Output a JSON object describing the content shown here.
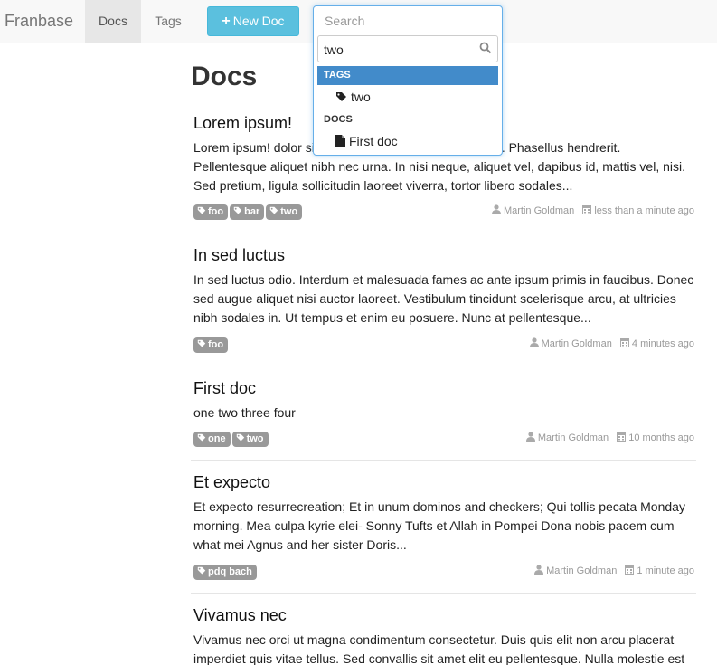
{
  "navbar": {
    "brand": "Franbase",
    "docs_label": "Docs",
    "tags_label": "Tags",
    "new_doc_label": "New Doc"
  },
  "search": {
    "placeholder": "Search",
    "value": "two",
    "tags_header": "TAGS",
    "tag_results": [
      "two"
    ],
    "docs_header": "DOCS",
    "doc_results": [
      "First doc"
    ]
  },
  "main": {
    "title": "Docs",
    "docs": [
      {
        "title": "Lorem ipsum!",
        "body": "Lorem ipsum! dolor sit amet, consectetur adipiscing elit. Phasellus hendrerit. Pellentesque aliquet nibh nec urna. In nisi neque, aliquet vel, dapibus id, mattis vel, nisi. Sed pretium, ligula sollicitudin laoreet viverra, tortor libero sodales...",
        "tags": [
          "foo",
          "bar",
          "two"
        ],
        "author": "Martin Goldman",
        "time": "less than a minute ago"
      },
      {
        "title": "In sed luctus",
        "body": "In sed luctus odio. Interdum et malesuada fames ac ante ipsum primis in faucibus. Donec sed augue aliquet nisi auctor laoreet. Vestibulum tincidunt scelerisque arcu, at ultricies nibh sodales in. Ut tempus et enim eu posuere. Nunc at pellentesque...",
        "tags": [
          "foo"
        ],
        "author": "Martin Goldman",
        "time": "4 minutes ago"
      },
      {
        "title": "First doc",
        "body": "one two three four",
        "tags": [
          "one",
          "two"
        ],
        "author": "Martin Goldman",
        "time": "10 months ago"
      },
      {
        "title": "Et expecto",
        "body": "Et expecto resurrecreation; Et in unum dominos and checkers; Qui tollis pecata Monday morning. Mea culpa kyrie elei- Sonny Tufts et Allah in Pompei Dona nobis pacem cum what mei Agnus and her sister Doris...",
        "tags": [
          "pdq bach"
        ],
        "author": "Martin Goldman",
        "time": "1 minute ago"
      },
      {
        "title": "Vivamus nec",
        "body": "Vivamus nec orci ut magna condimentum consectetur. Duis quis elit non arcu placerat imperdiet quis vitae tellus. Sed convallis sit amet elit eu pellentesque. Nulla molestie est"
      }
    ]
  },
  "colors": {
    "accent": "#5bc0de",
    "selected": "#428bca",
    "tag_bg": "#999999"
  }
}
